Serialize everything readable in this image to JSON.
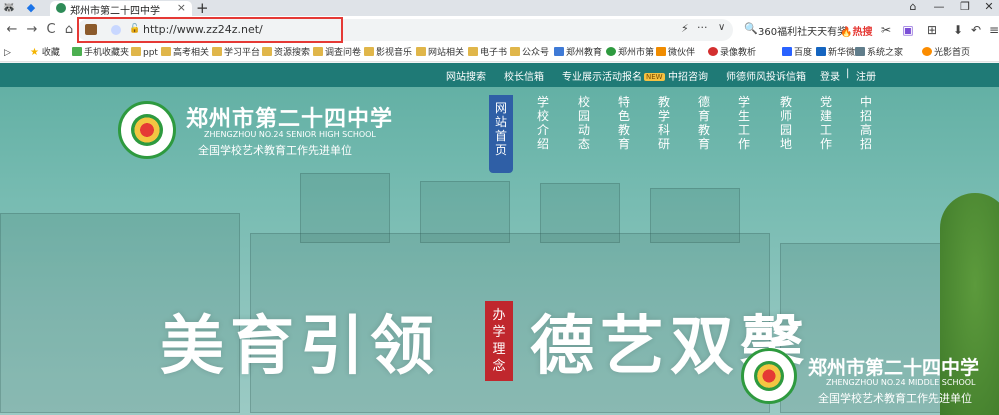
{
  "tab": {
    "title": "郑州市第二十四中学",
    "close": "×",
    "new_tab": "+"
  },
  "toolbar": {
    "back": "←",
    "forward": "→",
    "reload": "C",
    "home": "⌂",
    "url": "http://www.zz24z.net/",
    "lightning": "⚡",
    "more": "···",
    "dropdown": "∨",
    "search_text": "360福利社天天有奖",
    "hot_label": "🔥热搜"
  },
  "bookmarks": [
    {
      "label": "收藏"
    },
    {
      "label": "手机收藏夹"
    },
    {
      "label": "ppt"
    },
    {
      "label": "高考相关"
    },
    {
      "label": "学习平台"
    },
    {
      "label": "资源搜索"
    },
    {
      "label": "调查问卷"
    },
    {
      "label": "影视音乐"
    },
    {
      "label": "网站相关"
    },
    {
      "label": "电子书"
    },
    {
      "label": "公众号"
    },
    {
      "label": "郑州教育"
    },
    {
      "label": "郑州市第"
    },
    {
      "label": "微伙伴"
    },
    {
      "label": "录像教析"
    },
    {
      "label": "百度"
    },
    {
      "label": "新华微博"
    },
    {
      "label": "系统之家"
    },
    {
      "label": "光影首页"
    }
  ],
  "site": {
    "topbar": {
      "items": [
        "网站搜索",
        "校长信箱",
        "专业展示活动报名",
        "中招咨询",
        "师德师风投诉信箱"
      ],
      "badge": "NEW",
      "login": "登录",
      "sep": "|",
      "register": "注册"
    },
    "school_name": "郑州市第二十四中学",
    "school_en": "ZHENGZHOU NO.24 SENIOR HIGH SCHOOL",
    "school_honor": "全国学校艺术教育工作先进单位",
    "nav": [
      {
        "label": "网站首页",
        "active": true
      },
      {
        "label": "学校介绍"
      },
      {
        "label": "校园动态"
      },
      {
        "label": "特色教育"
      },
      {
        "label": "教学科研"
      },
      {
        "label": "德育教育"
      },
      {
        "label": "学生工作"
      },
      {
        "label": "教师园地"
      },
      {
        "label": "党建工作"
      },
      {
        "label": "中招高招"
      }
    ],
    "slogan_left": "美育引领",
    "slogan_right": "德艺双馨",
    "stamp": "办学理念",
    "footer_name": "郑州市第二十四中学",
    "footer_en": "ZHENGZHOU NO.24 MIDDLE SCHOOL",
    "footer_honor": "全国学校艺术教育工作先进单位"
  },
  "colors": {
    "accent": "#1f7a76",
    "highlight": "#e53935",
    "nav_active": "#2f5fa6",
    "stamp": "#c0272d"
  }
}
